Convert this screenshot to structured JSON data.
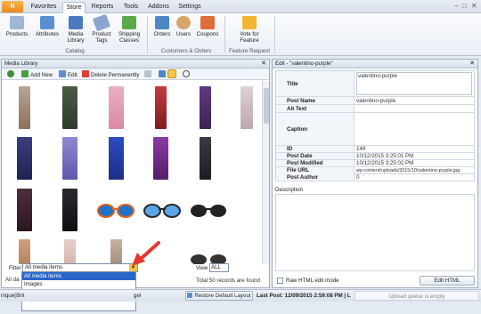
{
  "app_button": "N",
  "tabs": [
    "Favorites",
    "Store",
    "Reports",
    "Tools",
    "Addons",
    "Settings"
  ],
  "active_tab": "Store",
  "window_controls": [
    "−",
    "□",
    "✕"
  ],
  "ribbon": {
    "catalog": {
      "label": "Catalog",
      "buttons": [
        "Products",
        "Attributes",
        "Media Library",
        "Product Tags",
        "Shipping Classes"
      ]
    },
    "customers": {
      "label": "Customers & Orders",
      "buttons": [
        "Orders",
        "Users",
        "Coupons"
      ]
    },
    "feature": {
      "label": "Feature Request",
      "buttons": [
        "Vote for Feature"
      ]
    }
  },
  "media_panel": {
    "title": "Media Library",
    "toolbar": {
      "add": "Add New",
      "edit": "Edit",
      "delete": "Delete Permanently"
    },
    "filter_label": "Filter",
    "filter_value": "All media items",
    "filter_options": [
      "All media items",
      "Images"
    ],
    "view_label": "View",
    "view_value": "ALL",
    "records_text": "Total 50 records are found",
    "side_label": "All da"
  },
  "edit_panel": {
    "title": "Edit - \"valentino-purple\"",
    "fields": [
      {
        "key": "Title",
        "value": "valentino-purple"
      },
      {
        "key": "Post Name",
        "value": "valentino-purple"
      },
      {
        "key": "Alt Text",
        "value": ""
      },
      {
        "key": "Caption",
        "value": ""
      },
      {
        "key": "ID",
        "value": "149"
      },
      {
        "key": "Post Date",
        "value": "10/12/2015 3:25:01 PM"
      },
      {
        "key": "Post Modified",
        "value": "10/12/2015 3:25:02 PM"
      },
      {
        "key": "File URL",
        "value": "wp-content/uploads/2015/10/valentino-purple.jpg"
      },
      {
        "key": "Post Author",
        "value": "0"
      }
    ],
    "description_label": "Description",
    "raw_html_label": "Raw HTML edit mode",
    "edit_html_button": "Edit HTML"
  },
  "statusbar": {
    "left": "nique(Brit",
    "mid": "gel",
    "restore": "Restore Default Layout",
    "last_post": "Last Post: 12/09/2015 2:59:08 PM | L",
    "queue": "Upload queue is empty"
  },
  "colors": {
    "accent": "#2a67c9",
    "arrow": "#e53a2f",
    "orange": "#e8891a"
  }
}
